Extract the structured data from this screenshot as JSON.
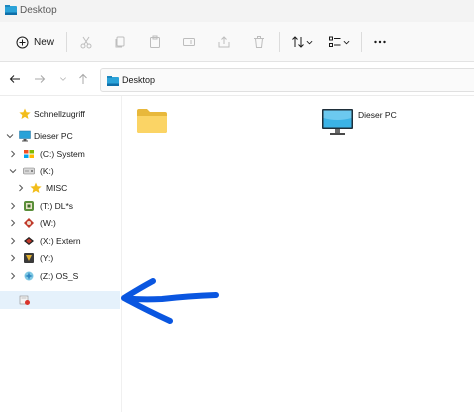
{
  "window": {
    "title": "Desktop"
  },
  "toolbar": {
    "new_label": "New"
  },
  "address": {
    "path": "Desktop"
  },
  "sidebar": {
    "items": [
      {
        "label": "Schnellzugriff"
      },
      {
        "label": "Dieser PC"
      },
      {
        "label": "(C:) System"
      },
      {
        "label": "(K:)"
      },
      {
        "label": "MISC"
      },
      {
        "label": "(T:) DL*s"
      },
      {
        "label": "(W:)"
      },
      {
        "label": "(X:) Extern"
      },
      {
        "label": "(Y:)"
      },
      {
        "label": "(Z:) OS_S"
      },
      {
        "label": ""
      }
    ]
  },
  "content": {
    "items": [
      {
        "label": "",
        "icon": "folder-icon"
      },
      {
        "label": "Dieser PC",
        "icon": "monitor-icon"
      }
    ]
  },
  "annotation": {
    "color": "#0a56e0",
    "icon": "hand-drawn-arrow"
  }
}
